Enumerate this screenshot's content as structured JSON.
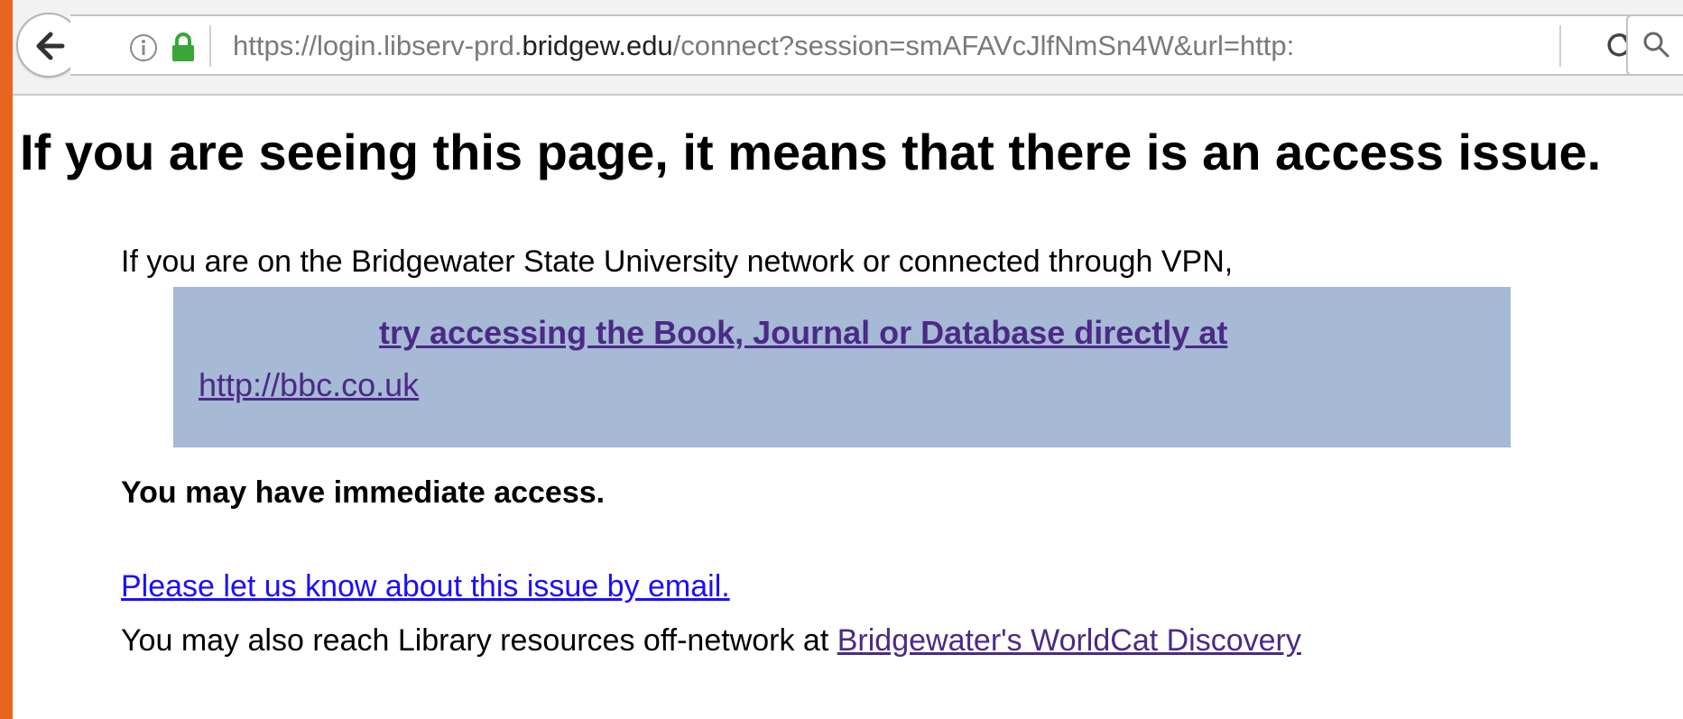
{
  "browser": {
    "url_prefix": "https://login.libserv-prd.",
    "url_domain": "bridgew.edu",
    "url_suffix": "/connect?session=smAFAVcJlfNmSn4W&url=http:",
    "icons": {
      "back": "back-arrow-icon",
      "info": "info-icon",
      "lock": "lock-icon",
      "reload": "reload-icon",
      "search": "search-icon"
    }
  },
  "page": {
    "heading": "If you are seeing this page, it means that there is an access issue.",
    "vpn_text": "If you are on the Bridgewater State University network or connected through VPN,",
    "direct_link_text": "try accessing the Book, Journal or Database directly at",
    "direct_url": "http://bbc.co.uk",
    "immediate_access": "You may have immediate access.",
    "email_link": "Please let us know about this issue by email.",
    "offnetwork_text": "You may also reach Library resources off-network at ",
    "worldcat_link": "Bridgewater's WorldCat Discovery"
  },
  "colors": {
    "frame": "#e8651e",
    "highlight_box": "#a6b9d5",
    "visited_link": "#4b2a86",
    "link": "#1a0dff",
    "lock": "#3aa63a"
  }
}
